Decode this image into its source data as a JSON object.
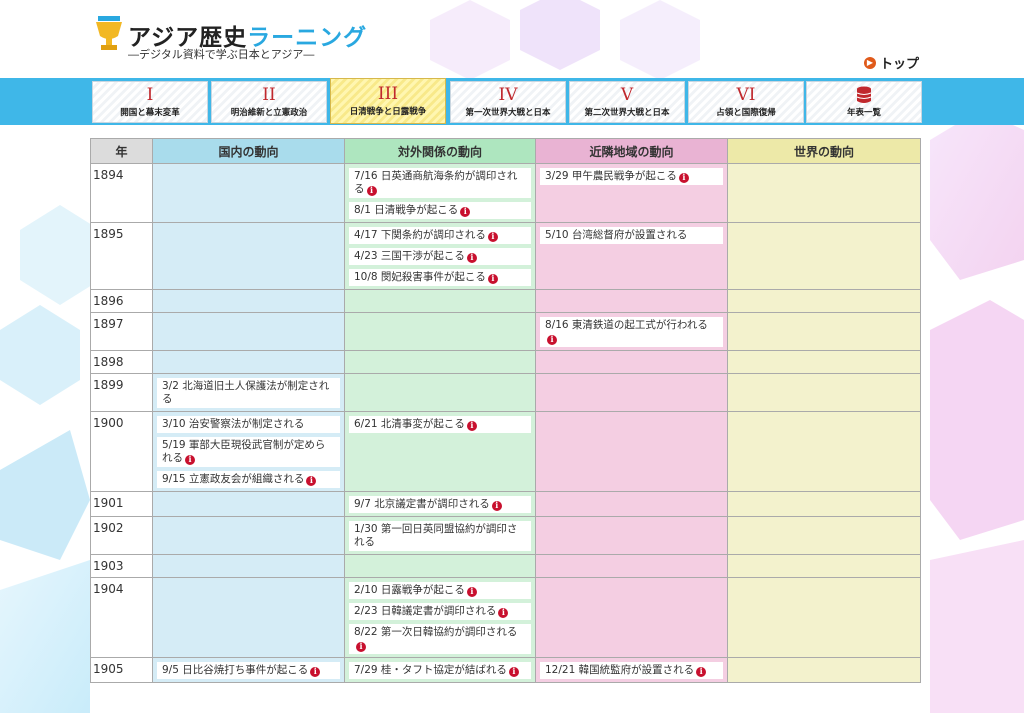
{
  "header": {
    "logo_title_main": "アジア歴史",
    "logo_title_accent": "ラーニング",
    "logo_subtitle": "―デジタル資料で学ぶ日本とアジア―",
    "top_link": "トップ"
  },
  "nav": {
    "items": [
      {
        "num": "I",
        "label": "開国と幕末変革",
        "active": false
      },
      {
        "num": "II",
        "label": "明治維新と立憲政治",
        "active": false
      },
      {
        "num": "III",
        "label": "日清戦争と日露戦争",
        "active": true
      },
      {
        "num": "IV",
        "label": "第一次世界大戦と日本",
        "active": false
      },
      {
        "num": "V",
        "label": "第二次世界大戦と日本",
        "active": false
      },
      {
        "num": "VI",
        "label": "占領と国際復帰",
        "active": false
      },
      {
        "num": "",
        "label": "年表一覧",
        "active": false,
        "icon": "database-icon"
      }
    ]
  },
  "table": {
    "headers": [
      "年",
      "国内の動向",
      "対外関係の動向",
      "近隣地域の動向",
      "世界の動向"
    ],
    "rows": [
      {
        "year": "1894",
        "domestic": [],
        "foreign": [
          {
            "text": "7/16 日英通商航海条約が調印される"
          },
          {
            "text": "8/1 日清戦争が起こる"
          }
        ],
        "neighbor": [
          {
            "text": "3/29 甲午農民戦争が起こる"
          }
        ],
        "world": []
      },
      {
        "year": "1895",
        "domestic": [],
        "foreign": [
          {
            "text": "4/17 下関条約が調印される"
          },
          {
            "text": "4/23 三国干渉が起こる"
          },
          {
            "text": "10/8 閔妃殺害事件が起こる"
          }
        ],
        "neighbor": [
          {
            "text": "5/10 台湾総督府が設置される",
            "noinfo": true
          }
        ],
        "world": []
      },
      {
        "year": "1896",
        "domestic": [],
        "foreign": [],
        "neighbor": [],
        "world": []
      },
      {
        "year": "1897",
        "domestic": [],
        "foreign": [],
        "neighbor": [
          {
            "text": "8/16 東清鉄道の起工式が行われる"
          }
        ],
        "world": []
      },
      {
        "year": "1898",
        "domestic": [],
        "foreign": [],
        "neighbor": [],
        "world": []
      },
      {
        "year": "1899",
        "domestic": [
          {
            "text": "3/2 北海道旧土人保護法が制定される",
            "noinfo": true
          }
        ],
        "foreign": [],
        "neighbor": [],
        "world": []
      },
      {
        "year": "1900",
        "domestic": [
          {
            "text": "3/10 治安警察法が制定される",
            "noinfo": true
          },
          {
            "text": "5/19 軍部大臣現役武官制が定められる"
          },
          {
            "text": "9/15 立憲政友会が組織される"
          }
        ],
        "foreign": [
          {
            "text": "6/21 北清事変が起こる"
          }
        ],
        "neighbor": [],
        "world": []
      },
      {
        "year": "1901",
        "domestic": [],
        "foreign": [
          {
            "text": "9/7 北京議定書が調印される"
          }
        ],
        "neighbor": [],
        "world": []
      },
      {
        "year": "1902",
        "domestic": [],
        "foreign": [
          {
            "text": "1/30 第一回日英同盟協約が調印される",
            "noinfo": true
          }
        ],
        "neighbor": [],
        "world": []
      },
      {
        "year": "1903",
        "domestic": [],
        "foreign": [],
        "neighbor": [],
        "world": []
      },
      {
        "year": "1904",
        "domestic": [],
        "foreign": [
          {
            "text": "2/10 日露戦争が起こる"
          },
          {
            "text": "2/23 日韓議定書が調印される"
          },
          {
            "text": "8/22 第一次日韓協約が調印される"
          }
        ],
        "neighbor": [],
        "world": []
      },
      {
        "year": "1905",
        "domestic": [
          {
            "text": "9/5 日比谷焼打ち事件が起こる"
          }
        ],
        "foreign": [
          {
            "text": "7/29 桂・タフト協定が結ばれる"
          }
        ],
        "neighbor": [
          {
            "text": "12/21 韓国統監府が設置される"
          }
        ],
        "world": []
      }
    ]
  }
}
